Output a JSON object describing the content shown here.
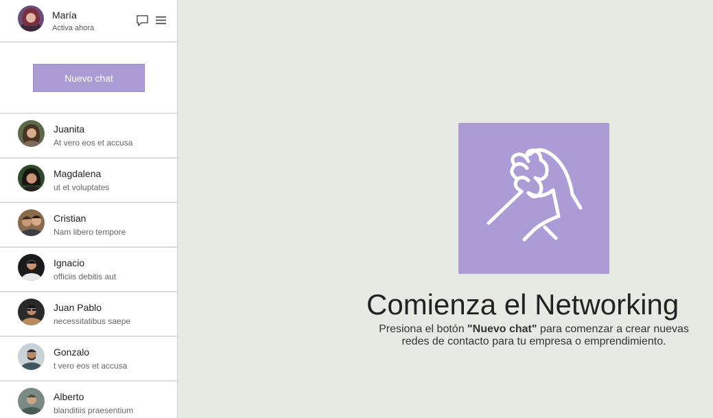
{
  "profile": {
    "name": "María",
    "status": "Activa ahora"
  },
  "header_icons": [
    "chat-bubble-icon",
    "menu-icon"
  ],
  "new_chat_button": "Nuevo chat",
  "contacts": [
    {
      "name": "Juanita",
      "preview": "At vero eos et accusa"
    },
    {
      "name": "Magdalena",
      "preview": "ut et voluptates"
    },
    {
      "name": "Cristian",
      "preview": "Nam libero tempore"
    },
    {
      "name": "Ignacio",
      "preview": "officiis debitis aut"
    },
    {
      "name": "Juan Pablo",
      "preview": "necessitatibus saepe"
    },
    {
      "name": "Gonzalo",
      "preview": "t vero eos et accusa"
    },
    {
      "name": "Alberto",
      "preview": "blanditiis praesentium"
    }
  ],
  "hero": {
    "icon": "handshake-icon",
    "title": "Comienza el Networking",
    "desc_before": "Presiona el botón ",
    "desc_bold": "\"Nuevo chat\"",
    "desc_after": " para comenzar a crear nuevas redes de contacto para tu empresa o emprendimiento."
  },
  "colors": {
    "accent": "#ab9cd6",
    "background": "#e7e9e3",
    "sidebar": "#ffffff"
  }
}
